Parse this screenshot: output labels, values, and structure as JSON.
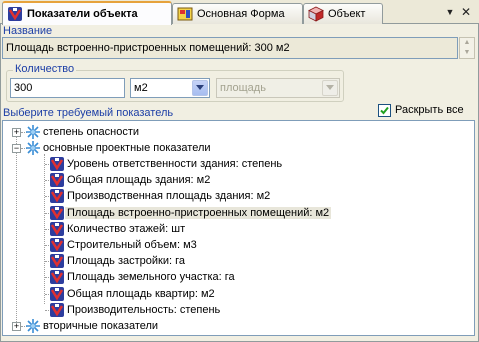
{
  "tabs": [
    {
      "label": "Показатели объекта",
      "icon": "indicator-icon",
      "active": true
    },
    {
      "label": "Основная Форма",
      "icon": "form-icon",
      "active": false
    },
    {
      "label": "Объект",
      "icon": "cube-icon",
      "active": false
    }
  ],
  "window_controls": {
    "dropdown": "▼",
    "close": "✕"
  },
  "name": {
    "caption": "Название",
    "value": "Площадь встроенно-пристроенных помещений: 300 м2"
  },
  "quantity": {
    "caption": "Количество",
    "value": "300",
    "unit": "м2",
    "measure_placeholder": "площадь"
  },
  "indicator_caption": "Выберите требуемый показатель",
  "expand_all": {
    "label": "Раскрыть все",
    "checked": true
  },
  "tree": {
    "groups": [
      {
        "label": "степень опасности",
        "expanded": false
      },
      {
        "label": "основные проектные показатели",
        "expanded": true
      },
      {
        "label": "вторичные показатели",
        "expanded": false
      }
    ],
    "items": [
      "Уровень ответственности здания: степень",
      "Общая площадь здания: м2",
      "Производственная площадь здания: м2",
      "Площадь встроенно-пристроенных помещений: м2",
      "Количество этажей: шт",
      "Строительный объем: м3",
      "Площадь застройки: га",
      "Площадь земельного участка: га",
      "Общая площадь квартир: м2",
      "Производительность: степень"
    ],
    "selected_item": 3
  }
}
